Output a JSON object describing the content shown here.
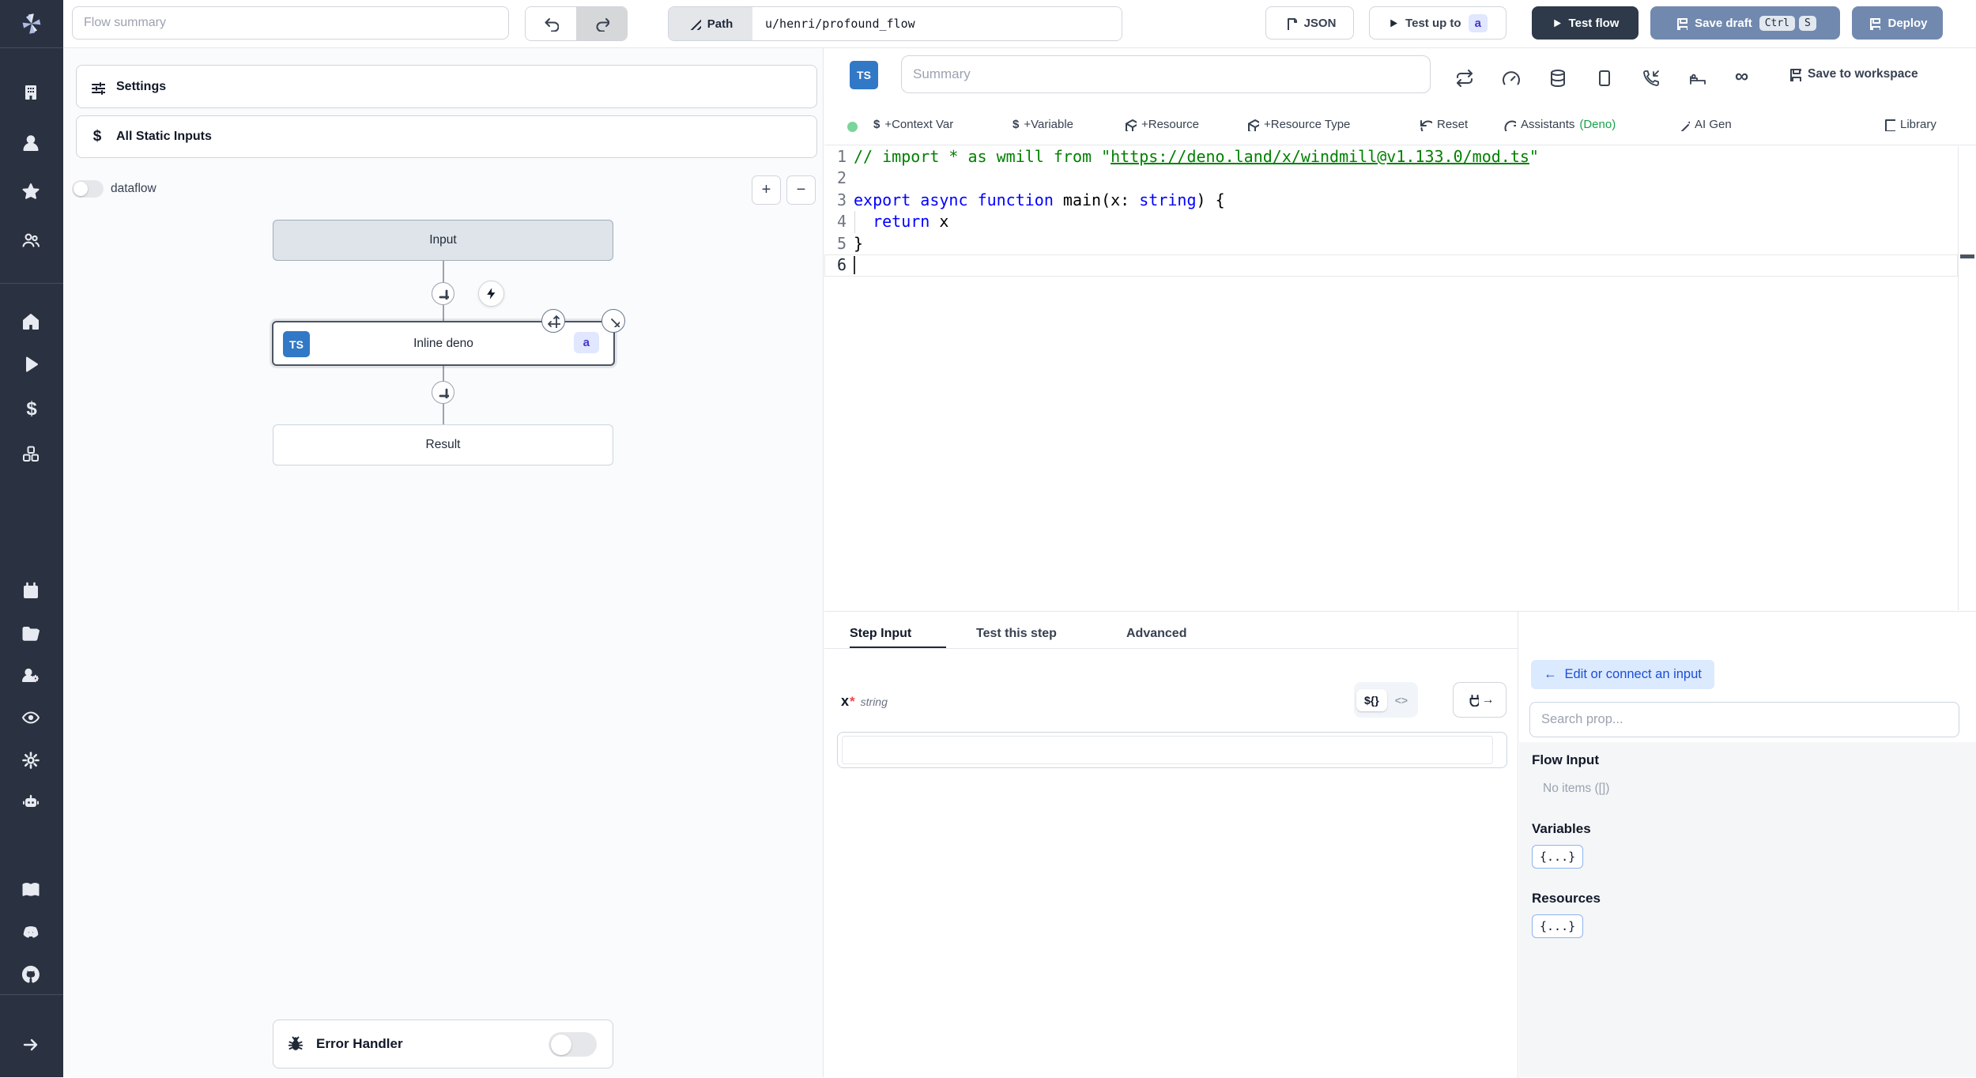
{
  "topbar": {
    "flow_summary_placeholder": "Flow summary",
    "path_label": "Path",
    "path_value": "u/henri/profound_flow",
    "json_button": "JSON",
    "test_up_to": "Test up to",
    "test_up_to_badge": "a",
    "test_flow": "Test flow",
    "save_draft": "Save draft",
    "kbd": [
      "Ctrl",
      "S"
    ],
    "deploy": "Deploy"
  },
  "sidebar": {
    "icons": [
      "building",
      "user",
      "star",
      "user-group",
      "home",
      "play",
      "dollar",
      "cubes",
      "calendar",
      "folder-open",
      "user-group-gear",
      "eye",
      "gear",
      "robot",
      "book",
      "discord",
      "github",
      "arrow-right"
    ]
  },
  "flow": {
    "settings": "Settings",
    "all_static_inputs": "All Static Inputs",
    "dataflow": "dataflow",
    "plus": "+",
    "minus": "−",
    "input_node": "Input",
    "step_node": {
      "lang": "TS",
      "title": "Inline deno",
      "badge": "a"
    },
    "result_node": "Result",
    "error_handler": "Error Handler"
  },
  "editor": {
    "lang_badge": "TS",
    "summary_placeholder": "Summary",
    "save_to_workspace": "Save to workspace",
    "infinity_glyph": "∞",
    "toolbar": {
      "dollar": "$",
      "context_var": "+Context Var",
      "variable": "+Variable",
      "resource": "+Resource",
      "resource_type": "+Resource Type",
      "reset": "Reset",
      "assistants": "Assistants",
      "assistants_lang": "(Deno)",
      "ai_gen": "AI Gen",
      "library": "Library"
    },
    "code": {
      "lines": [
        [
          {
            "text": "// import * as wmill from \"",
            "type": "comment"
          },
          {
            "text": "https://deno.land/x/windmill@v1.133.0/mod.ts",
            "type": "comment-link"
          },
          {
            "text": "\"",
            "type": "comment"
          }
        ],
        [],
        [
          {
            "text": "export",
            "type": "keyword"
          },
          {
            "text": " ",
            "type": "plain"
          },
          {
            "text": "async",
            "type": "keyword"
          },
          {
            "text": " ",
            "type": "plain"
          },
          {
            "text": "function",
            "type": "keyword"
          },
          {
            "text": " main(x: ",
            "type": "plain"
          },
          {
            "text": "string",
            "type": "keyword"
          },
          {
            "text": ") {",
            "type": "plain"
          }
        ],
        [
          {
            "text": "  ",
            "type": "plain"
          },
          {
            "text": "return",
            "type": "keyword"
          },
          {
            "text": " x",
            "type": "plain"
          }
        ],
        [
          {
            "text": "}",
            "type": "plain"
          }
        ],
        []
      ]
    }
  },
  "panel": {
    "tabs": [
      "Step Input",
      "Test this step",
      "Advanced"
    ],
    "active_tab": "Step Input",
    "arg": {
      "name": "x",
      "required": "*",
      "type": "string"
    },
    "mode_toggle": {
      "template": "${}",
      "code": "<>"
    },
    "plug_arrow": "→"
  },
  "connect": {
    "back_arrow": "←",
    "back_label": "Edit or connect an input",
    "search_placeholder": "Search prop...",
    "flow_input": "Flow Input",
    "no_items": "No items ([])",
    "variables": "Variables",
    "resources": "Resources",
    "object_chip": "{...}"
  },
  "colors": {
    "sidebar": "#2A3140",
    "dark_button": "#2E3949",
    "steel_blue": "#7189AE",
    "badge_bg": "#E0E7FF",
    "badge_text": "#4338CA",
    "connect_pill_bg": "#DBEAFE",
    "connect_pill_text": "#1D4ED8",
    "assistants_lang_green": "#16A34A",
    "ts_badge_blue": "#3178C6",
    "status_dot_green": "#7BD49A",
    "comment_green": "#008000",
    "keyword_blue": "#0000FF"
  }
}
